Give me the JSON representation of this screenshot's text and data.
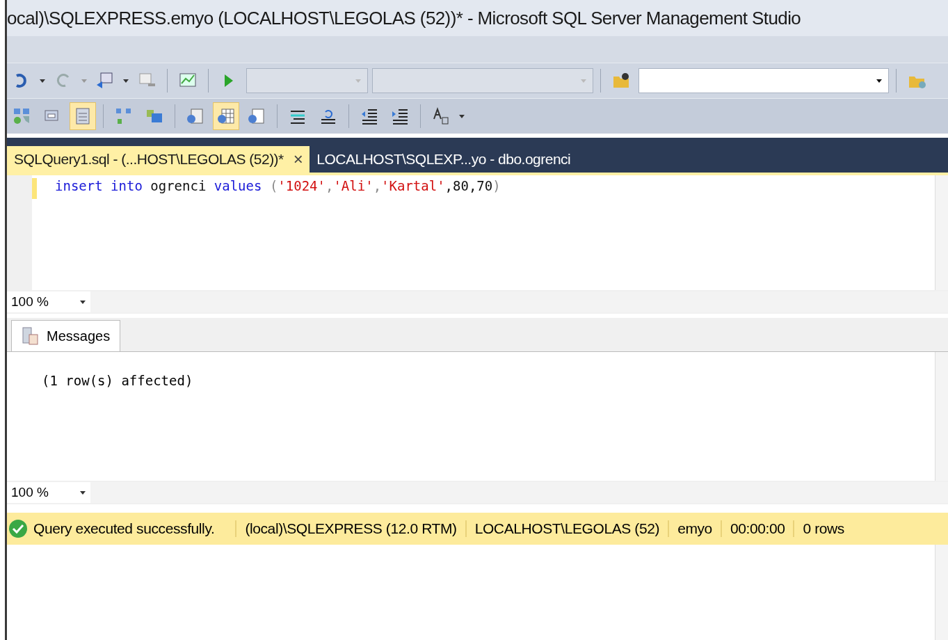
{
  "window": {
    "title": "ocal)\\SQLEXPRESS.emyo (LOCALHOST\\LEGOLAS (52))* - Microsoft SQL Server Management Studio"
  },
  "toolbar1": {
    "combos": [
      {
        "disabled": true
      },
      {
        "disabled": true
      },
      {
        "disabled": false
      }
    ]
  },
  "toolbar2": {
    "buttons": [
      {
        "pressed": false
      },
      {
        "pressed": false
      },
      {
        "pressed": true
      },
      {
        "pressed": false
      },
      {
        "pressed": false
      },
      {
        "pressed": false
      },
      {
        "pressed": true
      },
      {
        "pressed": false
      },
      {
        "pressed": false
      },
      {
        "pressed": false
      },
      {
        "pressed": false
      },
      {
        "pressed": false
      },
      {
        "pressed": false
      }
    ]
  },
  "tabs": [
    {
      "label": "SQLQuery1.sql - (...HOST\\LEGOLAS (52))*",
      "selected": true,
      "close": "×"
    },
    {
      "label": "LOCALHOST\\SQLEXP...yo - dbo.ogrenci",
      "selected": false
    }
  ],
  "editor": {
    "lines": [
      [
        {
          "kind": "keyword",
          "text": "insert into"
        },
        {
          "kind": "plain",
          "text": " ogrenci "
        },
        {
          "kind": "keyword",
          "text": "values"
        },
        {
          "kind": "paren",
          "text": " ("
        },
        {
          "kind": "string",
          "text": "'1024'"
        },
        {
          "kind": "punct",
          "text": ","
        },
        {
          "kind": "string",
          "text": "'Ali'"
        },
        {
          "kind": "punct",
          "text": ","
        },
        {
          "kind": "string",
          "text": "'Kartal'"
        },
        {
          "kind": "plain",
          "text": ",80,70"
        },
        {
          "kind": "paren",
          "text": ")"
        }
      ]
    ],
    "zoom": "100 %"
  },
  "results": {
    "tabs": [
      {
        "label": "Messages",
        "selected": true
      }
    ],
    "messages": [
      "(1 row(s) affected)"
    ],
    "zoom": "100 %"
  },
  "status_bar": {
    "message": "Query executed successfully.",
    "items": [
      "(local)\\SQLEXPRESS (12.0 RTM)",
      "LOCALHOST\\LEGOLAS (52)",
      "emyo",
      "00:00:00",
      "0 rows"
    ]
  }
}
